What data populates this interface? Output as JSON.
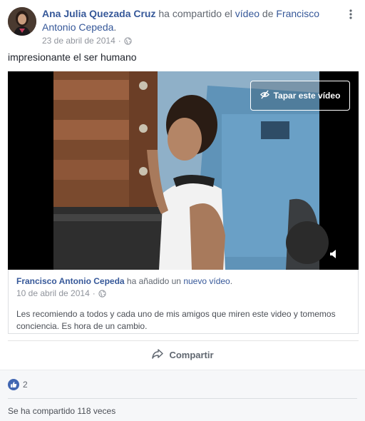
{
  "post": {
    "author": "Ana Julia Quezada Cruz",
    "action": " ha compartido el ",
    "video_word": "vídeo",
    "of_word": " de ",
    "source_name": "Francisco Antonio Cepeda",
    "period": ".",
    "date": "23 de abril de 2014",
    "separator": "·",
    "text": "impresionante el ser humano"
  },
  "video": {
    "hide_label": "Tapar este vídeo"
  },
  "shared": {
    "author": "Francisco Antonio Cepeda",
    "action": " ha añadido un ",
    "new_word": "nuevo vídeo",
    "period": ".",
    "date": "10 de abril de 2014",
    "separator": "·",
    "description": "Les recomiendo a todos y cada uno de mis amigos que miren este video y tomemos conciencia. Es hora de un cambio."
  },
  "actions": {
    "share_label": "Compartir"
  },
  "footer": {
    "like_count": "2",
    "share_count_text": "Se ha compartido 118 veces"
  },
  "icons": {
    "more": "more-options-icon",
    "globe": "globe-icon",
    "eye_slash": "eye-slash-icon",
    "volume": "volume-icon",
    "share": "share-arrow-icon",
    "like": "thumbs-up-icon"
  },
  "colors": {
    "link": "#365899",
    "like_badge": "#4267b2",
    "secondary_text": "#90949c"
  }
}
